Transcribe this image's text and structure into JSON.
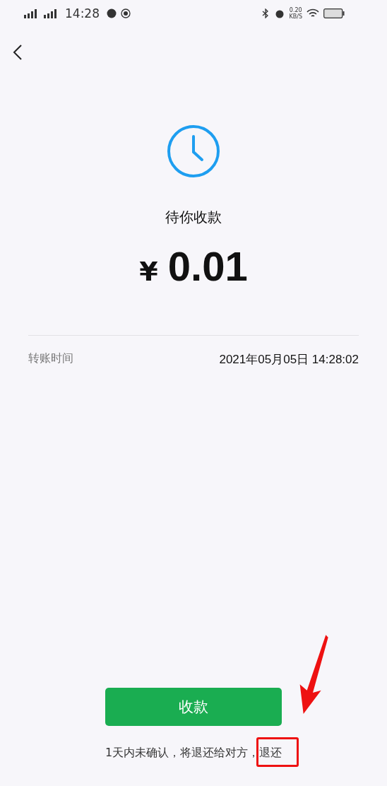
{
  "status_bar": {
    "time": "14:28",
    "net_speed": "0.20",
    "net_unit": "KB/S"
  },
  "status": "待你收款",
  "amount": {
    "currency": "¥",
    "value": "0.01"
  },
  "details": [
    {
      "label": "转账时间",
      "value": "2021年05月05日 14:28:02"
    }
  ],
  "confirm_button": "收款",
  "footer": {
    "note": "1天内未确认，将退还给对方，",
    "link": "退还"
  }
}
